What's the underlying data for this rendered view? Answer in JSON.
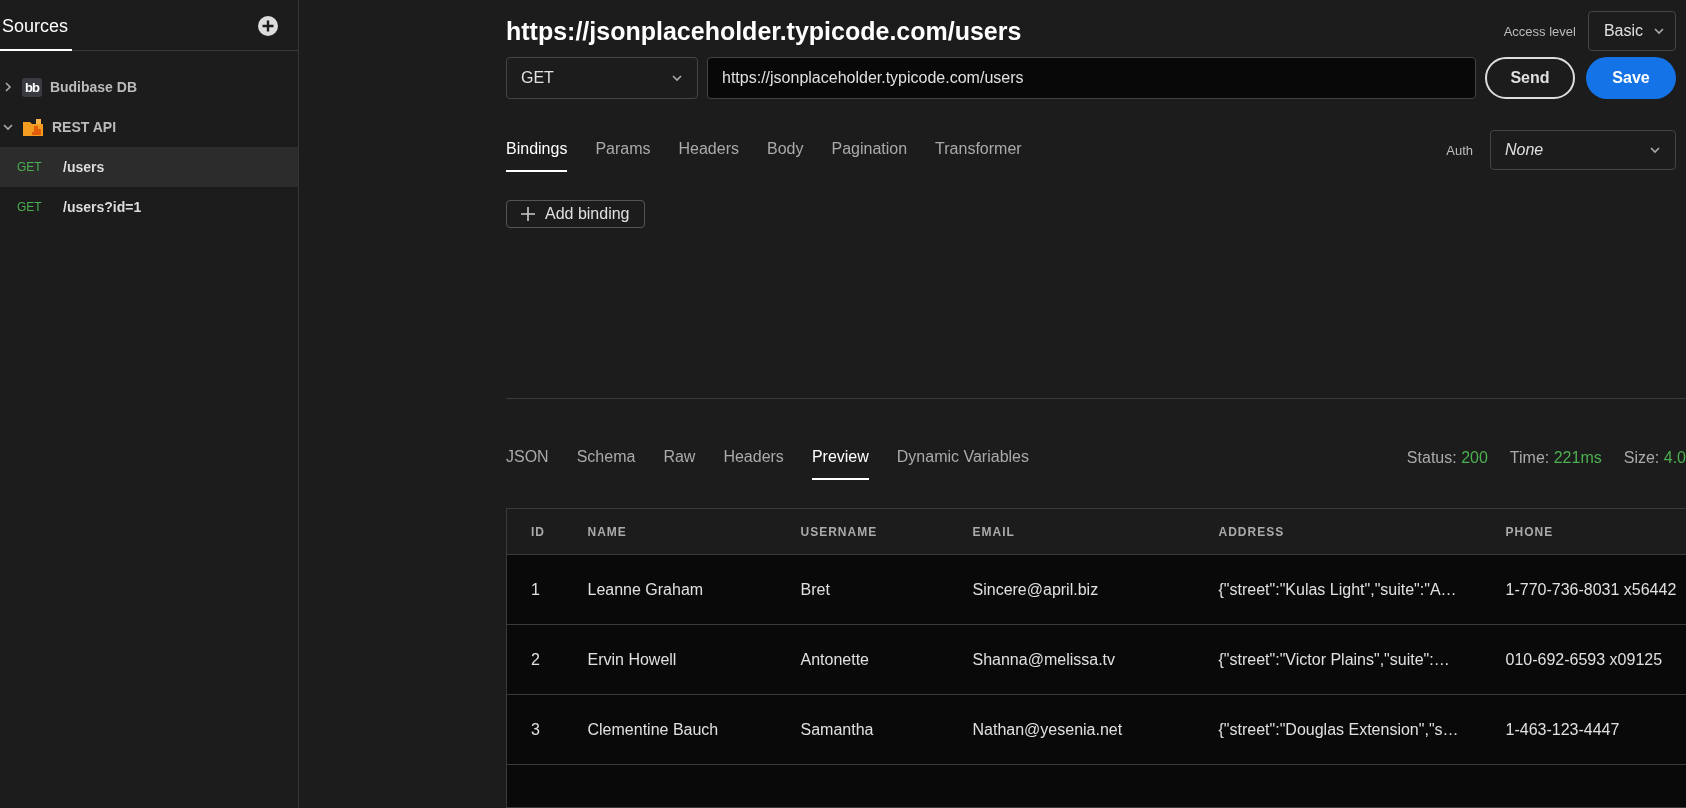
{
  "sidebar": {
    "tab": "Sources",
    "sources": [
      {
        "kind": "budibase",
        "logo_text": "bb",
        "name": "Budibase DB",
        "expanded": false
      },
      {
        "kind": "rest",
        "name": "REST API",
        "expanded": true,
        "queries": [
          {
            "method": "GET",
            "path": "/users",
            "selected": true
          },
          {
            "method": "GET",
            "path": "/users?id=1",
            "selected": false
          }
        ]
      }
    ]
  },
  "header": {
    "title": "https://jsonplaceholder.typicode.com/users",
    "access_level": {
      "label": "Access level",
      "value": "Basic"
    }
  },
  "request": {
    "method": "GET",
    "url": "https://jsonplaceholder.typicode.com/users",
    "send": "Send",
    "save": "Save"
  },
  "request_tabs": [
    {
      "label": "Bindings",
      "selected": true
    },
    {
      "label": "Params",
      "selected": false
    },
    {
      "label": "Headers",
      "selected": false
    },
    {
      "label": "Body",
      "selected": false
    },
    {
      "label": "Pagination",
      "selected": false
    },
    {
      "label": "Transformer",
      "selected": false
    }
  ],
  "auth": {
    "label": "Auth",
    "value": "None"
  },
  "add_binding": "Add binding",
  "response_tabs": [
    {
      "label": "JSON",
      "selected": false
    },
    {
      "label": "Schema",
      "selected": false
    },
    {
      "label": "Raw",
      "selected": false
    },
    {
      "label": "Headers",
      "selected": false
    },
    {
      "label": "Preview",
      "selected": true
    },
    {
      "label": "Dynamic Variables",
      "selected": false
    }
  ],
  "response_stats": [
    {
      "label": "Status:",
      "value": "200"
    },
    {
      "label": "Time:",
      "value": "221ms"
    },
    {
      "label": "Size:",
      "value": "4.0"
    }
  ],
  "table": {
    "columns": [
      "ID",
      "NAME",
      "USERNAME",
      "EMAIL",
      "ADDRESS",
      "PHONE"
    ],
    "rows": [
      [
        "1",
        "Leanne Graham",
        "Bret",
        "Sincere@april.biz",
        "{\"street\":\"Kulas Light\",\"suite\":\"A…",
        "1-770-736-8031 x56442"
      ],
      [
        "2",
        "Ervin Howell",
        "Antonette",
        "Shanna@melissa.tv",
        "{\"street\":\"Victor Plains\",\"suite\":…",
        "010-692-6593 x09125"
      ],
      [
        "3",
        "Clementine Bauch",
        "Samantha",
        "Nathan@yesenia.net",
        "{\"street\":\"Douglas Extension\",\"s…",
        "1-463-123-4447"
      ]
    ]
  }
}
